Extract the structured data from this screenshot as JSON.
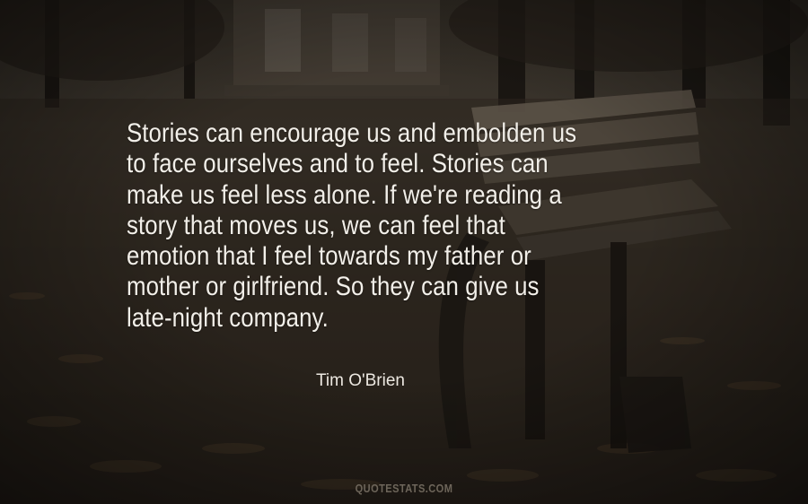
{
  "quote": {
    "lines": [
      "Stories can encourage us and embolden us",
      "to face ourselves and to feel. Stories can",
      "make us feel less alone. If we're reading a",
      "story that moves us, we can feel that",
      "emotion that I feel towards my father or",
      "mother or girlfriend. So they can give us",
      "late-night company."
    ],
    "author": "Tim O'Brien"
  },
  "watermark": "QUOTESTATS.COM",
  "colors": {
    "text": "#f2efe9",
    "background": "#2a251f",
    "watermark": "#6d655a"
  }
}
